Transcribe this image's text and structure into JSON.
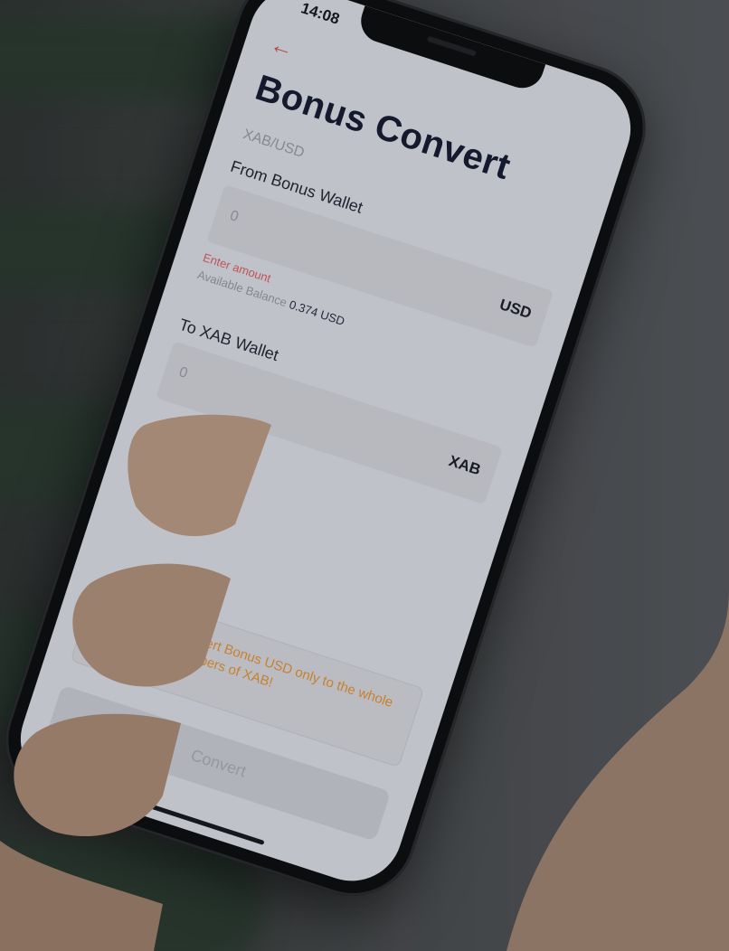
{
  "status_bar": {
    "time": "14:08"
  },
  "header": {
    "back_icon": "arrow-left-icon",
    "title": "Bonus Convert",
    "pair": "XAB/USD"
  },
  "from": {
    "label": "From Bonus Wallet",
    "value": "0",
    "unit": "USD",
    "error": "Enter amount",
    "balance_label": "Available Balance",
    "balance_value": "0.374 USD"
  },
  "to": {
    "label": "To XAB Wallet",
    "value": "0",
    "unit": "XAB"
  },
  "warning": {
    "icon": "warning-triangle-icon",
    "text": "You can convert Bonus USD only to the whole (integer) numbers of XAB!"
  },
  "actions": {
    "convert_label": "Convert"
  },
  "colors": {
    "accent_error": "#c8565a",
    "warning": "#d08530",
    "title": "#15192e"
  }
}
